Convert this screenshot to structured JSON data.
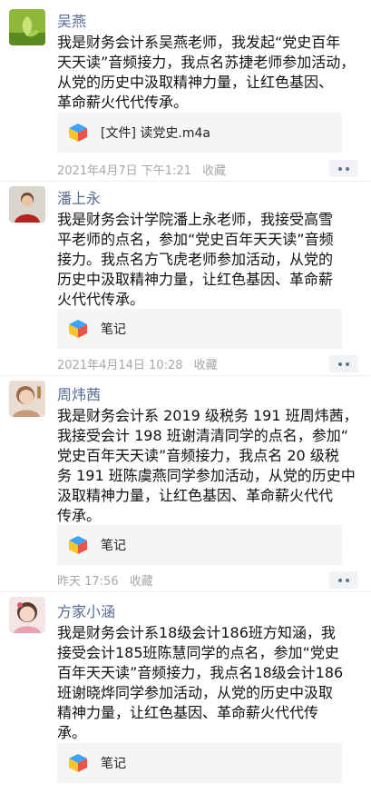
{
  "posts": [
    {
      "name": "吴燕",
      "text": "我是财务会计系吴燕老师，我发起“党史百年\n天天读”音频接力，我点名苏捷老师参加活动，\n从党的历史中汲取精神力量，让红色基因、\n革命薪火代代传承。",
      "card_label": "[文件] 读党史.m4a",
      "time": "2021年4月7日 下午1:21",
      "action": "收藏"
    },
    {
      "name": "潘上永",
      "text": "我是财务会计学院潘上永老师，我接受高雪\n平老师的点名，参加“党史百年天天读”音频\n接力。我点名方飞虎老师参加活动，从党的\n历史中汲取精神力量，让红色基因、革命薪\n火代代传承。",
      "card_label": "笔记",
      "time": "2021年4月14日 10:28",
      "action": "收藏"
    },
    {
      "name": "周炜茜",
      "text": "我是财务会计系 2019 级税务 191 班周炜茜，\n我接受会计 198 班谢清清同学的点名，参加“\n党史百年天天读”音频接力，我点名 20 级税\n务 191 班陈虞燕同学参加活动，从党的历史中\n汲取精神力量，让红色基因、革命薪火代代\n传承。",
      "card_label": "笔记",
      "time": "昨天 17:56",
      "action": "收藏"
    },
    {
      "name": "方家小涵",
      "text": "我是财务会计系18级会计186班方知涵，我\n接受会计185班陈慧同学的点名，参加“党史\n百年天天读”音频接力，我点名18级会计186\n班谢晓烨同学参加活动，从党的历史中汲取\n精神力量，让红色基因、革命薪火代代传\n承。",
      "card_label": "笔记",
      "time": "",
      "action": ""
    }
  ]
}
